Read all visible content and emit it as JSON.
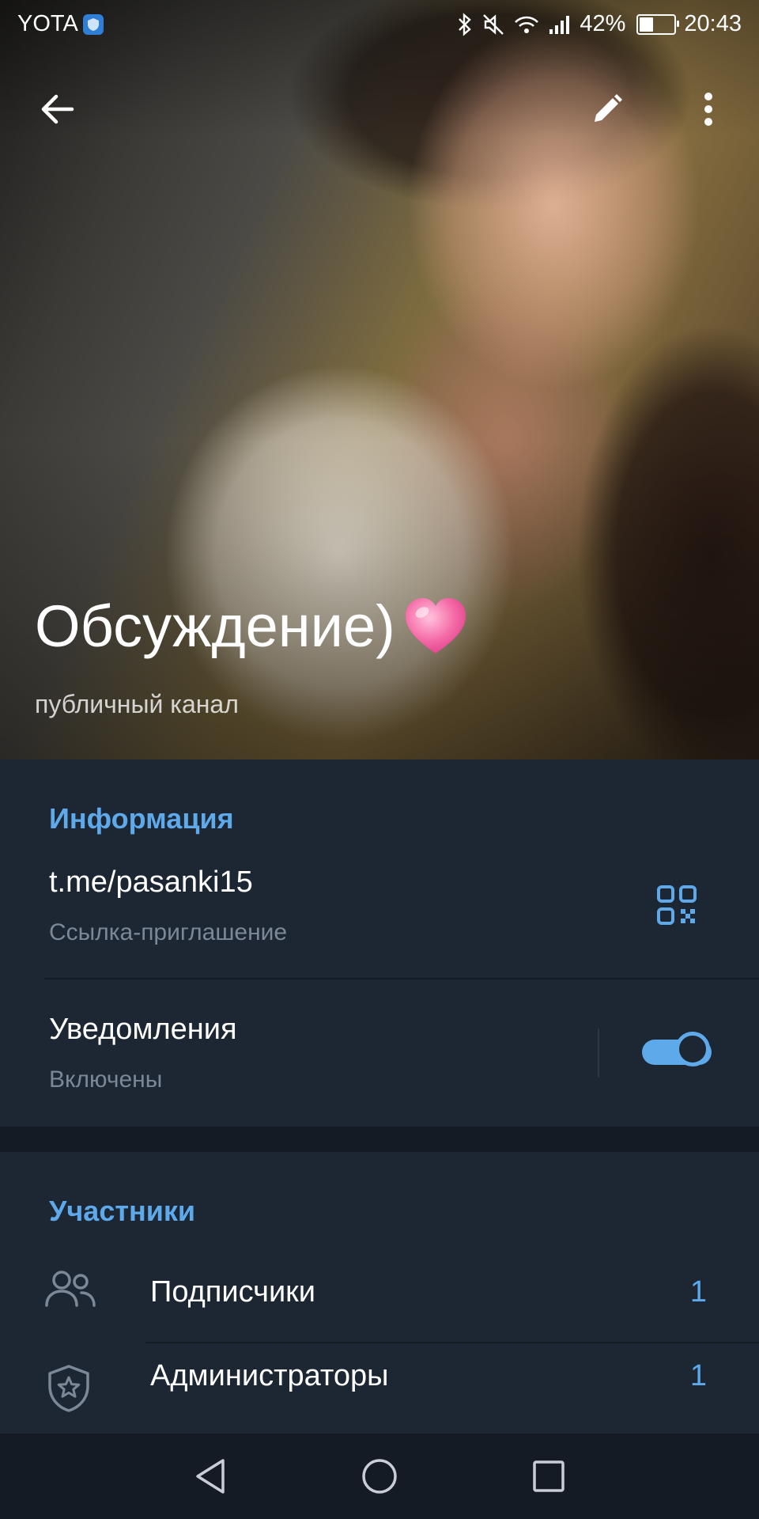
{
  "status_bar": {
    "carrier": "YOTA",
    "battery_percent": "42%",
    "battery_level": 0.42,
    "time": "20:43",
    "icons": [
      "bluetooth-icon",
      "mute-icon",
      "wifi-icon",
      "signal-icon",
      "battery-icon"
    ]
  },
  "header": {
    "title": "Обсуждение)",
    "title_emoji": "heart-emoji",
    "subtitle": "публичный канал",
    "icons": [
      "back-arrow-icon",
      "pencil-icon",
      "more-vert-icon"
    ]
  },
  "info": {
    "section_title": "Информация",
    "link": "t.me/pasanki15",
    "link_caption": "Ссылка-приглашение",
    "qr_icon": "qr-code-icon",
    "notifications_label": "Уведомления",
    "notifications_state": "Включены",
    "notifications_enabled": true
  },
  "members": {
    "section_title": "Участники",
    "items": [
      {
        "label": "Подписчики",
        "count": "1",
        "icon": "people-icon"
      },
      {
        "label": "Администраторы",
        "count": "1",
        "icon": "shield-star-icon"
      }
    ]
  },
  "navbar": {
    "icons": [
      "nav-back-icon",
      "nav-home-icon",
      "nav-recents-icon"
    ]
  },
  "colors": {
    "accent": "#5ea9ea",
    "background": "#1d2633",
    "separator": "#141b24"
  }
}
